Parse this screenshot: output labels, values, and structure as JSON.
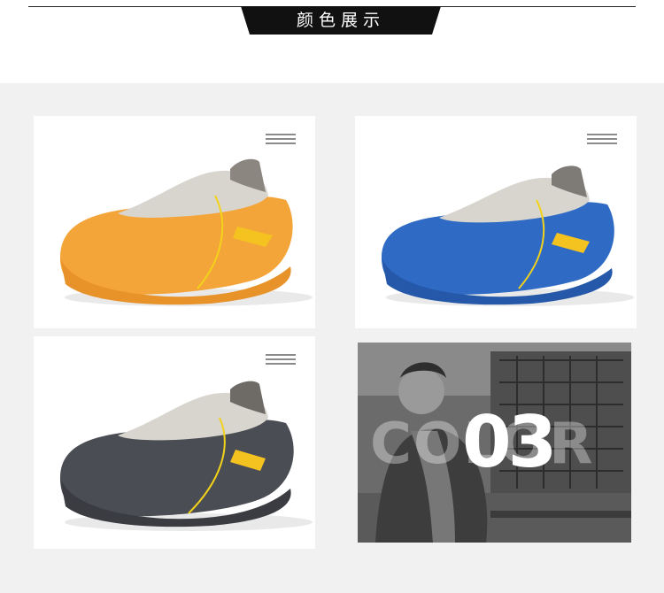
{
  "header": {
    "title": "颜色展示"
  },
  "products": [
    {
      "color_name": "orange",
      "color": "#f4a53a",
      "menu_icon": "hamburger-icon"
    },
    {
      "color_name": "blue",
      "color": "#2f6bc4",
      "menu_icon": "hamburger-icon"
    },
    {
      "color_name": "dark-gray",
      "color": "#4a4d54",
      "menu_icon": "hamburger-icon"
    }
  ],
  "feature_photo": {
    "background_word": "COLOR",
    "number": "03"
  }
}
